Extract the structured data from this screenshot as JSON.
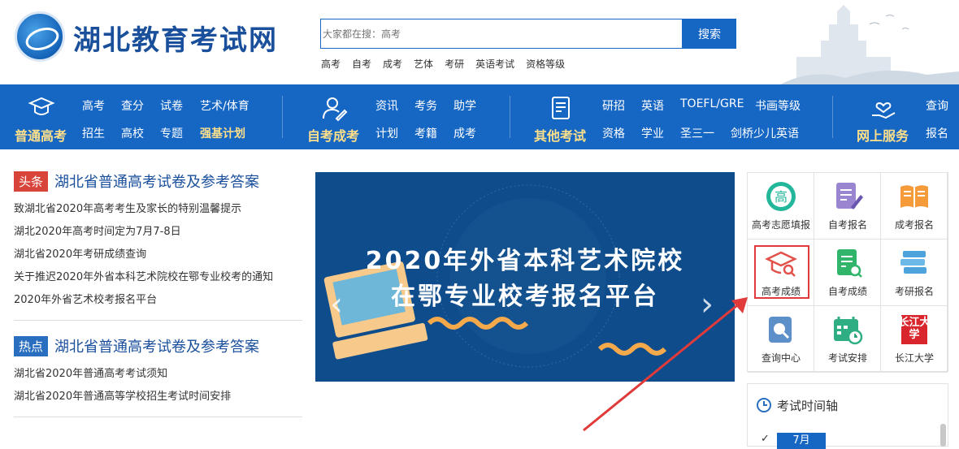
{
  "header": {
    "site_title": "湖北教育考试网",
    "search_placeholder": "大家都在搜：高考",
    "search_button": "搜索",
    "hotwords": [
      "高考",
      "自考",
      "成考",
      "艺体",
      "考研",
      "英语考试",
      "资格等级"
    ]
  },
  "nav": {
    "group1": {
      "title": "普通高考",
      "links": [
        "高考",
        "查分",
        "试卷",
        "艺术/体育",
        "招生",
        "高校",
        "专题",
        "强基计划"
      ]
    },
    "group2": {
      "title": "自考成考",
      "links": [
        "资讯",
        "考务",
        "助学",
        "计划",
        "考籍",
        "成考"
      ]
    },
    "group3": {
      "title": "其他考试",
      "links": [
        "研招",
        "英语",
        "TOEFL/GRE",
        "书画等级",
        "资格",
        "学业",
        "圣三一",
        "剑桥少儿英语"
      ]
    },
    "group4": {
      "title": "网上服务",
      "links": [
        "查询",
        "报名"
      ]
    }
  },
  "news": {
    "headline": {
      "badge": "头条",
      "title": "湖北省普通高考试卷及参考答案",
      "items": [
        "致湖北省2020年高考考生及家长的特别温馨提示",
        "湖北2020年高考时间定为7月7-8日",
        "湖北省2020年考研成绩查询",
        "关于推迟2020年外省本科艺术院校在鄂专业校考的通知",
        "2020年外省艺术校考报名平台"
      ]
    },
    "hot": {
      "badge": "热点",
      "title": "湖北省普通高考试卷及参考答案",
      "items": [
        "湖北省2020年普通高考考试须知",
        "湖北省2020年普通高等学校招生考试时间安排"
      ]
    }
  },
  "banner": {
    "line1": "2020年外省本科艺术院校",
    "line2": "在鄂专业校考报名平台"
  },
  "services": [
    {
      "label": "高考志愿填报",
      "icon": "gao-icon"
    },
    {
      "label": "自考报名",
      "icon": "edit-doc-icon"
    },
    {
      "label": "成考报名",
      "icon": "book-icon"
    },
    {
      "label": "高考成绩",
      "icon": "graduation-cap-search-icon"
    },
    {
      "label": "自考成绩",
      "icon": "doc-search-icon"
    },
    {
      "label": "考研报名",
      "icon": "books-stack-icon"
    },
    {
      "label": "查询中心",
      "icon": "search-doc-icon"
    },
    {
      "label": "考试安排",
      "icon": "calendar-clock-icon"
    },
    {
      "label": "长江大学",
      "icon": "changjiang-logo"
    }
  ],
  "services_logo_text": "长江大学",
  "timeline": {
    "title": "考试时间轴",
    "month": "7月"
  },
  "colors": {
    "brand_blue": "#1666c4",
    "nav_yellow": "#ffe08a",
    "badge_red": "#d9443a",
    "badge_blue": "#2a6fbf"
  }
}
